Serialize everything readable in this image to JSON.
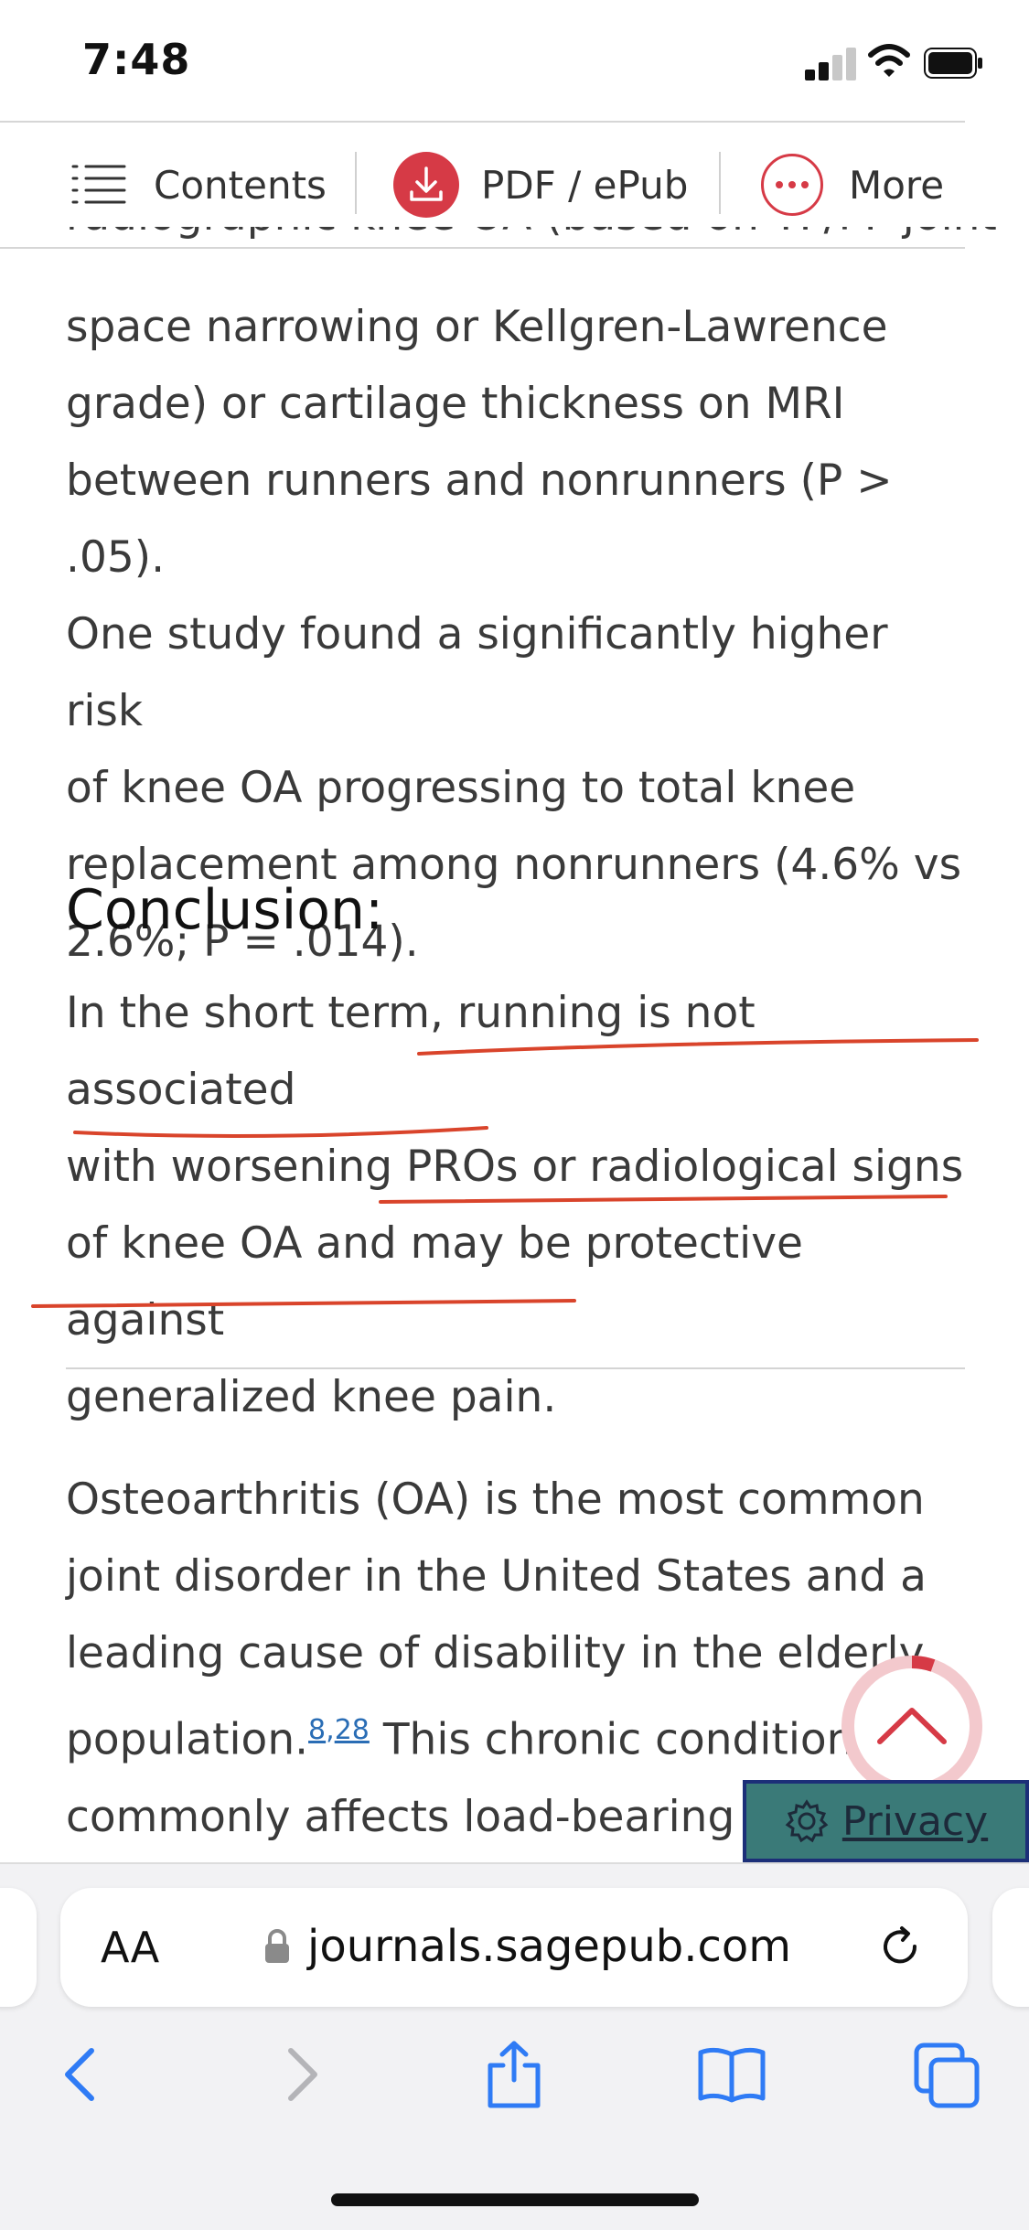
{
  "status_bar": {
    "time": "7:48"
  },
  "toolbar": {
    "contents_label": "Contents",
    "pdf_label": "PDF / ePub",
    "more_label": "More"
  },
  "article": {
    "cut_line": "radiographic knee OA (based on TF/PF joint-",
    "results_lines": [
      "space narrowing or Kellgren-Lawrence",
      "grade) or cartilage thickness on MRI",
      "between runners and nonrunners (P > .05).",
      "One study found a significantly higher risk",
      "of knee OA progressing to total knee",
      "replacement among nonrunners (4.6% vs",
      "2.6%; P = .014)."
    ],
    "conclusion_heading": "Conclusion:",
    "conclusion_lines": [
      "In the short term, running is not associated",
      "with worsening PROs or radiological signs",
      "of knee OA and may be protective against",
      "generalized knee pain."
    ],
    "intro_lines": [
      "Osteoarthritis (OA) is the most common",
      "joint disorder in the United States and a",
      "leading cause of disability in the elderly",
      "population.",
      "This chronic condition",
      "commonly affects load-bearing jo"
    ],
    "ref_8": "8",
    "ref_sep": ",",
    "ref_28": "28"
  },
  "privacy": {
    "label": "Privacy"
  },
  "safari": {
    "aa_label": "AA",
    "url": "journals.sagepub.com"
  },
  "colors": {
    "accent_red": "#d63a46",
    "annotation_red": "#d9442b",
    "link_blue": "#2a6db5",
    "privacy_bg": "#3a7a78",
    "ios_blue": "#2f7bf5"
  },
  "icons": [
    "list-icon",
    "download-icon",
    "more-dots-icon",
    "chevron-up-icon",
    "gear-icon",
    "lock-icon",
    "reload-icon",
    "back-icon",
    "forward-icon",
    "share-icon",
    "bookmarks-icon",
    "tabs-icon"
  ]
}
